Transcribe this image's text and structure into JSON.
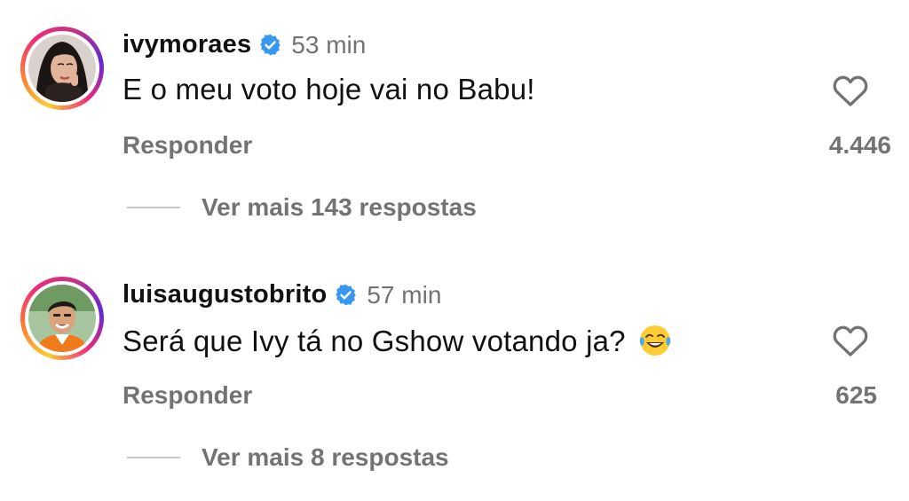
{
  "colors": {
    "text_primary": "#111111",
    "text_secondary": "#737373",
    "verified": "#3897f0",
    "divider": "#c7c7c7"
  },
  "comments": [
    {
      "username": "ivymoraes",
      "verified": true,
      "time": "53 min",
      "text": "E o meu voto hoje vai no Babu!",
      "reply_label": "Responder",
      "likes": "4.446",
      "view_more": "Ver mais 143 respostas",
      "like_icon": "heart-outline-icon"
    },
    {
      "username": "luisaugustobrito",
      "verified": true,
      "time": "57 min",
      "text": "Será que Ivy tá no Gshow votando ja?",
      "emoji": "face-with-tears-of-joy-emoji",
      "reply_label": "Responder",
      "likes": "625",
      "view_more": "Ver mais 8 respostas",
      "like_icon": "heart-outline-icon"
    }
  ]
}
